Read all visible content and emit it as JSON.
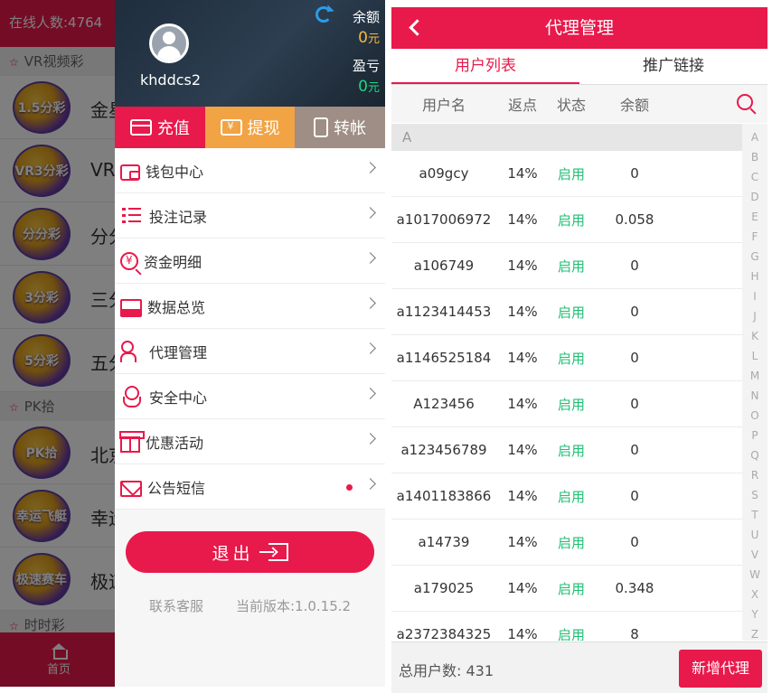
{
  "background_app": {
    "online_count": "在线人数:4764",
    "sections": [
      "VR视频彩",
      "PK拾",
      "时时彩"
    ],
    "games": [
      {
        "logo_text": "1.5分彩",
        "name": "金星"
      },
      {
        "logo_text": "VR3分彩",
        "name": "VR"
      },
      {
        "logo_text": "分分彩",
        "name": "分分"
      },
      {
        "logo_text": "3分彩",
        "name": "三分"
      },
      {
        "logo_text": "5分彩",
        "name": "五分"
      },
      {
        "logo_text": "PK拾",
        "name": "北京"
      },
      {
        "logo_text": "幸运飞艇",
        "name": "幸运"
      },
      {
        "logo_text": "极速赛车",
        "name": "极速"
      }
    ],
    "bottom_nav_home": "首页"
  },
  "drawer": {
    "username": "khddcs2",
    "balance_label": "余额",
    "balance_value": "0",
    "balance_unit": "元",
    "profit_label": "盈亏",
    "profit_value": "0",
    "profit_unit": "元",
    "actions": {
      "deposit": "充值",
      "withdraw": "提现",
      "transfer": "转帐"
    },
    "menu": [
      "钱包中心",
      "投注记录",
      "资金明细",
      "数据总览",
      "代理管理",
      "安全中心",
      "优惠活动",
      "公告短信"
    ],
    "logout_label": "退出",
    "contact_label": "联系客服",
    "version_label": "当前版本:1.0.15.2"
  },
  "agent_page": {
    "title": "代理管理",
    "tabs": [
      "用户列表",
      "推广链接"
    ],
    "columns": {
      "username": "用户名",
      "rebate": "返点",
      "status": "状态",
      "balance": "余额"
    },
    "group_letter": "A",
    "rows": [
      {
        "username": "a09gcy",
        "rebate": "14%",
        "status": "启用",
        "balance": "0"
      },
      {
        "username": "a1017006972",
        "rebate": "14%",
        "status": "启用",
        "balance": "0.058"
      },
      {
        "username": "a106749",
        "rebate": "14%",
        "status": "启用",
        "balance": "0"
      },
      {
        "username": "a1123414453",
        "rebate": "14%",
        "status": "启用",
        "balance": "0"
      },
      {
        "username": "a1146525184",
        "rebate": "14%",
        "status": "启用",
        "balance": "0"
      },
      {
        "username": "A123456",
        "rebate": "14%",
        "status": "启用",
        "balance": "0"
      },
      {
        "username": "a123456789",
        "rebate": "14%",
        "status": "启用",
        "balance": "0"
      },
      {
        "username": "a1401183866",
        "rebate": "14%",
        "status": "启用",
        "balance": "0"
      },
      {
        "username": "a14739",
        "rebate": "14%",
        "status": "启用",
        "balance": "0"
      },
      {
        "username": "a179025",
        "rebate": "14%",
        "status": "启用",
        "balance": "0.348"
      },
      {
        "username": "a2372384325",
        "rebate": "14%",
        "status": "启用",
        "balance": "8"
      }
    ],
    "index_letters": [
      "A",
      "B",
      "C",
      "D",
      "E",
      "F",
      "G",
      "H",
      "I",
      "J",
      "K",
      "L",
      "M",
      "N",
      "O",
      "P",
      "Q",
      "R",
      "S",
      "T",
      "U",
      "V",
      "W",
      "X",
      "Y",
      "Z"
    ],
    "total_label": "总用户数:",
    "total_value": "431",
    "add_button": "新增代理"
  },
  "colors": {
    "accent": "#e8194b",
    "enabled_green": "#1fbf73",
    "withdraw_orange": "#f2a343",
    "transfer_gray": "#9e8e85"
  }
}
